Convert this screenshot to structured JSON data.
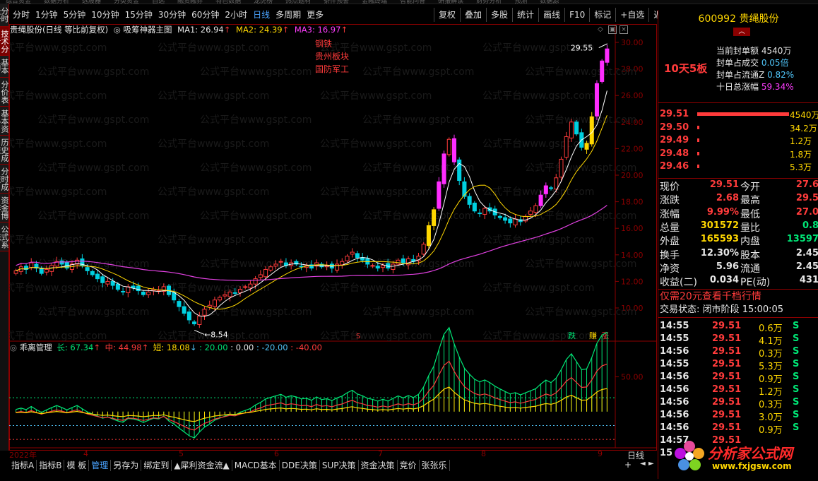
{
  "menu_strip": [
    "综合资金",
    "数据分析",
    "选股器",
    "分类资金",
    "自选",
    "融资融券",
    "特色数据",
    "龙虎榜",
    "热点题材",
    "条件预警",
    "金融终端",
    "智能问答",
    "研报解读",
    "财务分析",
    "预测",
    "数据源"
  ],
  "left_tabs": [
    "分时走势",
    "技术分析",
    "基本面",
    "分价表",
    "基本资料",
    "历史成交",
    "分时成交",
    "资金博弈",
    "公式系统"
  ],
  "period_tabs": [
    "分时",
    "1分钟",
    "5分钟",
    "10分钟",
    "15分钟",
    "30分钟",
    "60分钟",
    "2小时",
    "日线",
    "多周期",
    "更多"
  ],
  "toolbar": [
    "复权",
    "叠加",
    "多股",
    "统计",
    "画线",
    "F10",
    "标记",
    "+自选",
    "返回"
  ],
  "main": {
    "title": "贵绳股份(日线 等比前复权)",
    "indicator_name": "吸筹神器主图",
    "ma1": "MA1: 26.94",
    "ma2": "MA2: 24.39",
    "ma3": "MA3: 16.97",
    "tags": [
      "钢铁",
      "贵州板块",
      "国防军工"
    ],
    "watermark": "公式平台www.gspt.com",
    "high_label": "29.55",
    "low_label": "8.54",
    "y_ticks": [
      "30.00",
      "28.00",
      "26.00",
      "24.00",
      "22.00",
      "20.00",
      "18.00",
      "16.00",
      "14.00",
      "12.00",
      "10.00"
    ],
    "bottom_badges": [
      "跌",
      "赚",
      "涨"
    ]
  },
  "sub": {
    "name": "乖离管理",
    "long": "长: 67.34",
    "mid": "中: 44.98",
    "short": "短: 18.08",
    "l1": ": 20.00",
    "l2": ": 0.00",
    "l3": ": -20.00",
    "l4": ": -40.00",
    "y_tick": "50.00"
  },
  "dates": [
    "2022年",
    "4",
    "5",
    "6",
    "7",
    "8",
    "9"
  ],
  "bottom_tabs": [
    "指标A",
    "指标B",
    "模 板",
    "管理",
    "另存为",
    "绑定到",
    "▲犀利资金流▲",
    "MACD基本",
    "DDE决策",
    "SUP决策",
    "资金决策",
    "竞价",
    "张张乐"
  ],
  "bottom_right": "日线",
  "quote": {
    "code": "600992",
    "name": "贵绳股份",
    "board": "10天5板",
    "seal_amount_label": "当前封单额",
    "seal_amount": "4540万",
    "seal_turn_label": "封单占成交",
    "seal_turn": "0.05倍",
    "seal_float_label": "封单占流通Z",
    "seal_float": "0.82%",
    "ten_day_label": "十日总涨幅",
    "ten_day": "59.34%",
    "bids": [
      {
        "price": "29.51",
        "vol": "4540万",
        "bar": 1.0
      },
      {
        "price": "29.50",
        "vol": "34.2万",
        "bar": 0.01
      },
      {
        "price": "29.49",
        "vol": "1.2万",
        "bar": 0.005
      },
      {
        "price": "29.48",
        "vol": "1.8万",
        "bar": 0.005
      },
      {
        "price": "29.46",
        "vol": "5.3万",
        "bar": 0.005
      }
    ],
    "stats": [
      {
        "l": "现价",
        "v": "29.51",
        "l2": "今开",
        "v2": "27.6"
      },
      {
        "l": "涨跌",
        "v": "2.68",
        "l2": "最高",
        "v2": "29.5"
      },
      {
        "l": "涨幅",
        "v": "9.99%",
        "l2": "最低",
        "v2": "27.0"
      },
      {
        "l": "总量",
        "v": "301572",
        "l2": "量比",
        "v2": "0.8"
      },
      {
        "l": "外盘",
        "v": "165593",
        "l2": "内盘",
        "v2": "13597"
      },
      {
        "l": "换手",
        "v": "12.30%",
        "l2": "股本",
        "v2": "2.45"
      },
      {
        "l": "净资",
        "v": "5.96",
        "l2": "流通",
        "v2": "2.45"
      },
      {
        "l": "收益(二)",
        "v": "0.034",
        "l2": "PE(动)",
        "v2": "431"
      }
    ],
    "promo": "仅需20元查看千档行情",
    "state_label": "交易状态:",
    "state": "闭市阶段",
    "state_time": "15:00:05",
    "ticks": [
      {
        "t": "14:55",
        "p": "29.51",
        "v": "0.6万",
        "s": "S"
      },
      {
        "t": "14:55",
        "p": "29.51",
        "v": "4.1万",
        "s": "S"
      },
      {
        "t": "14:56",
        "p": "29.51",
        "v": "0.3万",
        "s": "S"
      },
      {
        "t": "14:55",
        "p": "29.51",
        "v": "5.3万",
        "s": "S"
      },
      {
        "t": "14:56",
        "p": "29.51",
        "v": "0.9万",
        "s": "S"
      },
      {
        "t": "14:56",
        "p": "29.51",
        "v": "1.2万",
        "s": "S"
      },
      {
        "t": "14:56",
        "p": "29.51",
        "v": "0.3万",
        "s": "S"
      },
      {
        "t": "14:56",
        "p": "29.51",
        "v": "3.0万",
        "s": "S"
      },
      {
        "t": "14:56",
        "p": "29.51",
        "v": "0.9万",
        "s": "S"
      },
      {
        "t": "14:57",
        "p": "29.51",
        "v": "",
        "s": ""
      },
      {
        "t": "15",
        "p": "",
        "v": "",
        "s": ""
      }
    ]
  },
  "logo": {
    "title": "分析家公式网",
    "url": "www.fxjgsw.com"
  }
}
